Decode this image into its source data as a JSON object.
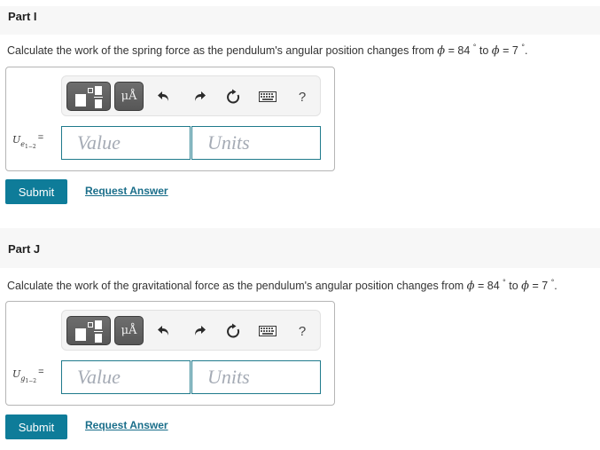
{
  "parts": [
    {
      "title": "Part I",
      "question_prefix": "Calculate the work of the spring force as the pendulum's angular position changes from ",
      "phi_symbol": "ϕ",
      "eq1": " = 84 ",
      "deg": "°",
      "to": " to ",
      "eq2": " = 7 ",
      "end": ".",
      "variable": {
        "symbol": "U",
        "sub": "e",
        "sub2": "1−2",
        "equals": "="
      },
      "value_placeholder": "Value",
      "units_placeholder": "Units",
      "submit_label": "Submit",
      "request_label": "Request Answer"
    },
    {
      "title": "Part J",
      "question_prefix": "Calculate the work of the gravitational force as the pendulum's angular position changes from ",
      "phi_symbol": "ϕ",
      "eq1": " = 84 ",
      "deg": "°",
      "to": " to ",
      "eq2": " = 7 ",
      "end": ".",
      "variable": {
        "symbol": "U",
        "sub": "g",
        "sub2": "1−2",
        "equals": "="
      },
      "value_placeholder": "Value",
      "units_placeholder": "Units",
      "submit_label": "Submit",
      "request_label": "Request Answer"
    }
  ],
  "toolbar": {
    "units_label": "μÅ",
    "help_label": "?",
    "icons": [
      "templates-icon",
      "units-icon",
      "undo-icon",
      "redo-icon",
      "reset-icon",
      "keyboard-icon",
      "help-icon"
    ]
  },
  "colors": {
    "accent": "#0e7c99",
    "input_border": "#1f7a8c",
    "link": "#1a6e8a",
    "header_bg": "#f7f7f7"
  }
}
